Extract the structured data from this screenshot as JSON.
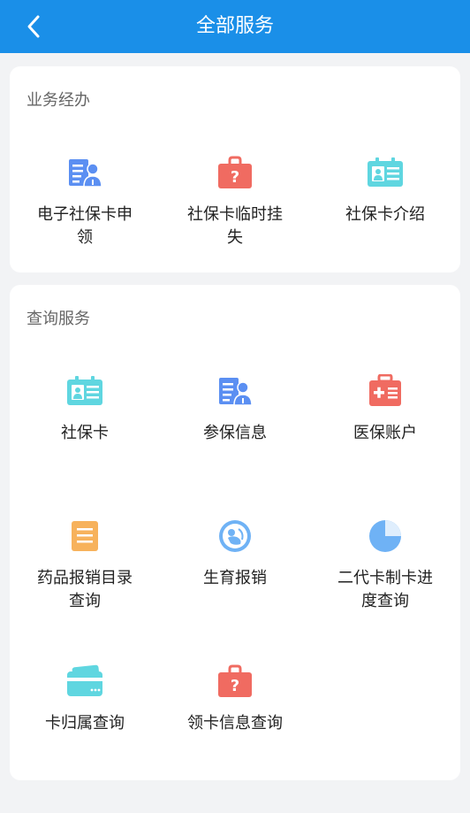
{
  "header": {
    "title": "全部服务"
  },
  "sections": [
    {
      "title": "业务经办",
      "items": [
        {
          "label": "电子社保卡申领",
          "icon": "id-person-icon"
        },
        {
          "label": "社保卡临时挂失",
          "icon": "question-bag-icon"
        },
        {
          "label": "社保卡介绍",
          "icon": "id-card-icon"
        }
      ]
    },
    {
      "title": "查询服务",
      "items": [
        {
          "label": "社保卡",
          "icon": "id-card-icon"
        },
        {
          "label": "参保信息",
          "icon": "id-person-icon"
        },
        {
          "label": "医保账户",
          "icon": "medical-kit-icon"
        },
        {
          "label": "药品报销目录查询",
          "icon": "document-list-icon"
        },
        {
          "label": "生育报销",
          "icon": "baby-icon"
        },
        {
          "label": "二代卡制卡进度查询",
          "icon": "pie-progress-icon"
        },
        {
          "label": "卡归属查询",
          "icon": "wallet-card-icon"
        },
        {
          "label": "领卡信息查询",
          "icon": "question-bag-icon"
        }
      ]
    }
  ],
  "colors": {
    "header": "#1a8fe8",
    "blue_icon": "#5b8ff2",
    "red_icon": "#f06b61",
    "teal_icon": "#5fd6e0",
    "orange_icon": "#f7b25c",
    "light_blue_icon": "#6fb2f5"
  }
}
